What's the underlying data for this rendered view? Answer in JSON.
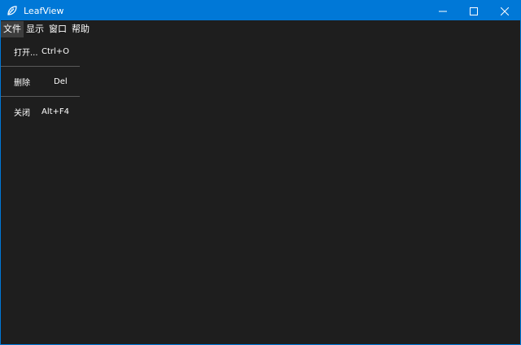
{
  "window": {
    "title": "LeafView"
  },
  "menubar": {
    "items": [
      {
        "label": "文件",
        "active": true
      },
      {
        "label": "显示"
      },
      {
        "label": "窗口"
      },
      {
        "label": "帮助"
      }
    ]
  },
  "file_menu": {
    "items": [
      {
        "label": "打开...",
        "shortcut": "Ctrl+O"
      },
      {
        "label": "删除",
        "shortcut": "Del"
      },
      {
        "label": "关闭",
        "shortcut": "Alt+F4"
      }
    ]
  },
  "colors": {
    "titlebar": "#0078d7",
    "background": "#1e1e1e",
    "menu_active": "#3d3d3d",
    "text": "#ffffff"
  },
  "icons": {
    "app": "leaf-icon",
    "minimize": "minimize-icon",
    "maximize": "maximize-icon",
    "close": "close-icon"
  }
}
